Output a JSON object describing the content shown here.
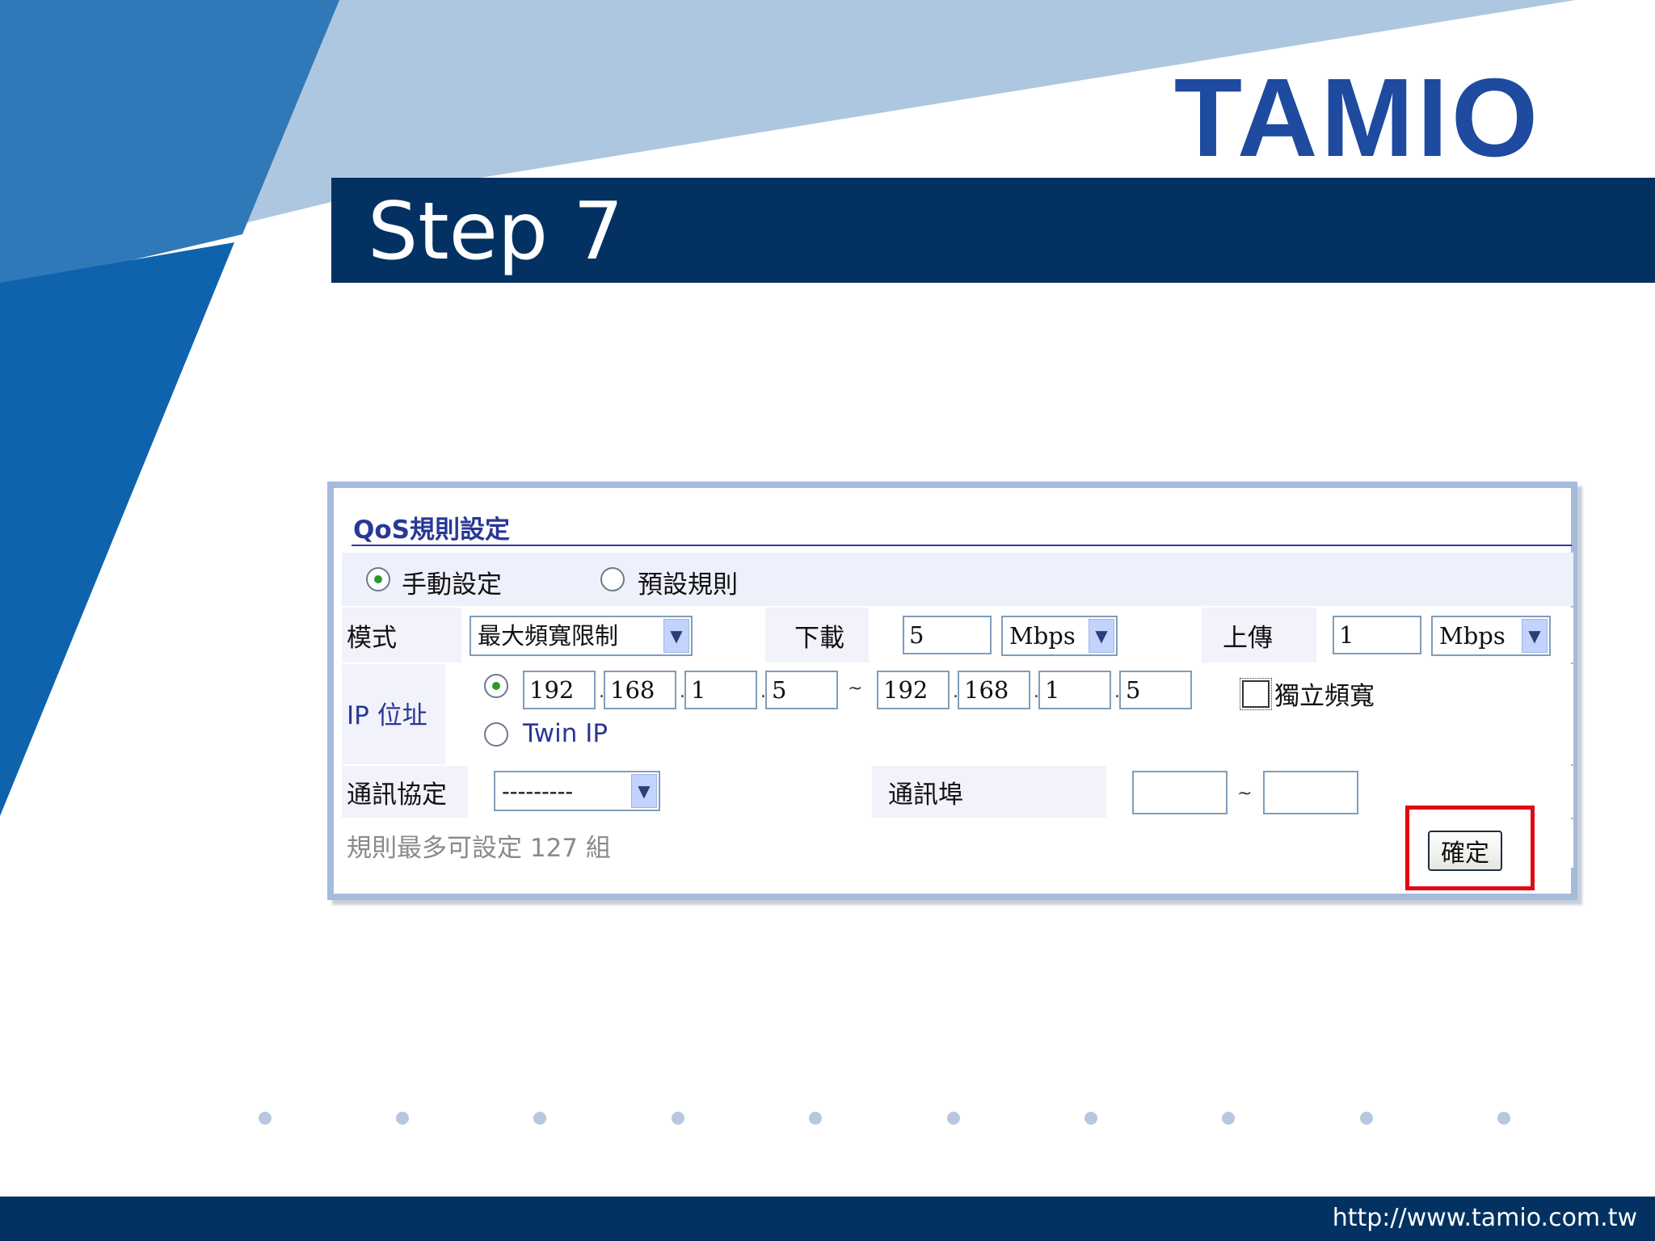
{
  "slide": {
    "logo": "TAMIO",
    "title": "Step 7",
    "footer_url": "http://www.tamio.com.tw"
  },
  "qos": {
    "title": "QoS規則設定",
    "setting_options": [
      {
        "label": "手動設定",
        "checked": true
      },
      {
        "label": "預設規則",
        "checked": false
      }
    ],
    "mode": {
      "label": "模式",
      "selected": "最大頻寬限制"
    },
    "download": {
      "label": "下載",
      "value": "5",
      "unit": "Mbps"
    },
    "upload": {
      "label": "上傳",
      "value": "1",
      "unit": "Mbps"
    },
    "ip": {
      "label": "IP 位址",
      "range_checked": true,
      "start": [
        "192",
        "168",
        "1",
        "5"
      ],
      "end": [
        "192",
        "168",
        "1",
        "5"
      ],
      "range_sep": "~",
      "octet_sep": ".",
      "twin_ip_label": "Twin IP",
      "twin_ip_checked": false,
      "independent_bw_label": "獨立頻寬",
      "independent_bw_checked": false
    },
    "protocol": {
      "label": "通訊協定",
      "selected": "---------"
    },
    "port": {
      "label": "通訊埠",
      "from": "",
      "to": "",
      "range_sep": "~"
    },
    "info_text": "規則最多可設定 127 組",
    "confirm_label": "確定"
  },
  "colors": {
    "header_navy": "#033262",
    "logo_blue": "#1e4a9f",
    "highlight_red": "#e30613",
    "panel_border": "#a5bbdc"
  }
}
